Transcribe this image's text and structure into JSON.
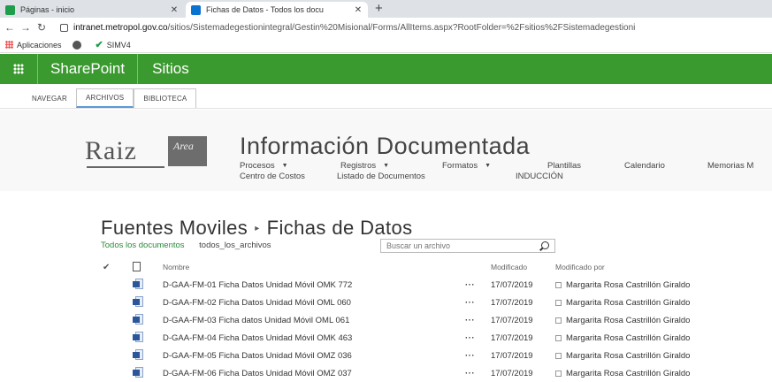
{
  "browser": {
    "tabs": [
      {
        "label": "Páginas - inicio",
        "favicon": "sharepoint-green-icon",
        "active": false
      },
      {
        "label": "Fichas de Datos - Todos los docu",
        "favicon": "sharepoint-blue-icon",
        "active": true
      }
    ],
    "url_host": "intranet.metropol.gov.co",
    "url_path": "/sitios/Sistemadegestionintegral/Gestin%20Misional/Forms/AllItems.aspx?RootFolder=%2Fsitios%2FSistemadegestioni",
    "bookmarks": [
      "Aplicaciones",
      "SIMV4"
    ]
  },
  "suite": {
    "brand": "SharePoint",
    "sites": "Sitios",
    "color": "#3b9a2f"
  },
  "ribbon": {
    "tabs": [
      "NAVEGAR",
      "ARCHIVOS",
      "BIBLIOTECA"
    ]
  },
  "site": {
    "logo_text": "Raiz",
    "logo_box_text": "Area",
    "title": "Información Documentada",
    "nav_row1": [
      "Procesos",
      "Registros",
      "Formatos",
      "Plantillas",
      "Calendario",
      "Memorias M"
    ],
    "nav_row2": [
      "Centro de Costos",
      "Listado de Documentos",
      "INDUCCIÓN"
    ]
  },
  "page": {
    "breadcrumb_parent": "Fuentes Moviles",
    "breadcrumb_sep": "▸",
    "title": "Fichas de Datos",
    "view_all": "Todos los documentos",
    "view_alt": "todos_los_archivos",
    "search_placeholder": "Buscar un archivo"
  },
  "table": {
    "headers": {
      "name": "Nombre",
      "modified": "Modificado",
      "modified_by": "Modificado por"
    },
    "rows": [
      {
        "name": "D-GAA-FM-01 Ficha Datos Unidad Móvil OMK 772",
        "modified": "17/07/2019",
        "by": "Margarita Rosa Castrillón Giraldo"
      },
      {
        "name": "D-GAA-FM-02 Ficha Datos Unidad Móvil OML 060",
        "modified": "17/07/2019",
        "by": "Margarita Rosa Castrillón Giraldo"
      },
      {
        "name": "D-GAA-FM-03 Ficha datos Unidad Móvil OML 061",
        "modified": "17/07/2019",
        "by": "Margarita Rosa Castrillón Giraldo"
      },
      {
        "name": "D-GAA-FM-04 Ficha Datos Unidad Móvil OMK 463",
        "modified": "17/07/2019",
        "by": "Margarita Rosa Castrillón Giraldo"
      },
      {
        "name": "D-GAA-FM-05 Ficha Datos Unidad Móvil OMZ 036",
        "modified": "17/07/2019",
        "by": "Margarita Rosa Castrillón Giraldo"
      },
      {
        "name": "D-GAA-FM-06 Ficha Datos Unidad Móvil OMZ 037",
        "modified": "17/07/2019",
        "by": "Margarita Rosa Castrillón Giraldo"
      }
    ]
  }
}
